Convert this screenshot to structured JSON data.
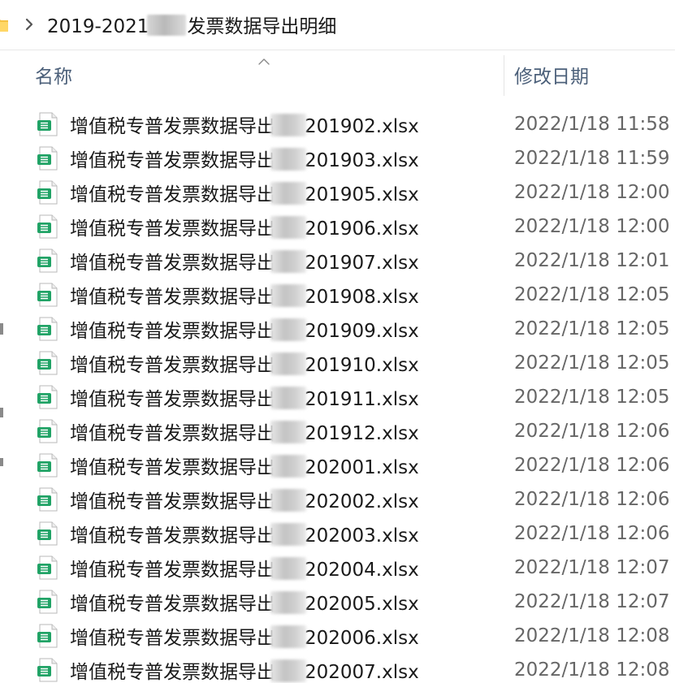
{
  "breadcrumb": {
    "folder_icon": "folder-icon",
    "separator_icon": "chevron-right-icon",
    "path_prefix": "2019-2021",
    "path_suffix": "发票数据导出明细"
  },
  "columns": {
    "name": "名称",
    "modified": "修改日期",
    "sort_icon": "sort-ascending-icon"
  },
  "file_icon": "excel-file-icon",
  "accent": "#21a366",
  "files": [
    {
      "name_prefix": "增值税专普发票数据导出",
      "name_suffix": "201902.xlsx",
      "modified": "2022/1/18 11:58"
    },
    {
      "name_prefix": "增值税专普发票数据导出",
      "name_suffix": "201903.xlsx",
      "modified": "2022/1/18 11:59"
    },
    {
      "name_prefix": "增值税专普发票数据导出",
      "name_suffix": "201905.xlsx",
      "modified": "2022/1/18 12:00"
    },
    {
      "name_prefix": "增值税专普发票数据导出",
      "name_suffix": "201906.xlsx",
      "modified": "2022/1/18 12:00"
    },
    {
      "name_prefix": "增值税专普发票数据导出",
      "name_suffix": "201907.xlsx",
      "modified": "2022/1/18 12:01"
    },
    {
      "name_prefix": "增值税专普发票数据导出",
      "name_suffix": "201908.xlsx",
      "modified": "2022/1/18 12:05"
    },
    {
      "name_prefix": "增值税专普发票数据导出",
      "name_suffix": "201909.xlsx",
      "modified": "2022/1/18 12:05"
    },
    {
      "name_prefix": "增值税专普发票数据导出",
      "name_suffix": "201910.xlsx",
      "modified": "2022/1/18 12:05"
    },
    {
      "name_prefix": "增值税专普发票数据导出",
      "name_suffix": "201911.xlsx",
      "modified": "2022/1/18 12:05"
    },
    {
      "name_prefix": "增值税专普发票数据导出",
      "name_suffix": "201912.xlsx",
      "modified": "2022/1/18 12:06"
    },
    {
      "name_prefix": "增值税专普发票数据导出",
      "name_suffix": "202001.xlsx",
      "modified": "2022/1/18 12:06"
    },
    {
      "name_prefix": "增值税专普发票数据导出",
      "name_suffix": "202002.xlsx",
      "modified": "2022/1/18 12:06"
    },
    {
      "name_prefix": "增值税专普发票数据导出",
      "name_suffix": "202003.xlsx",
      "modified": "2022/1/18 12:06"
    },
    {
      "name_prefix": "增值税专普发票数据导出",
      "name_suffix": "202004.xlsx",
      "modified": "2022/1/18 12:07"
    },
    {
      "name_prefix": "增值税专普发票数据导出",
      "name_suffix": "202005.xlsx",
      "modified": "2022/1/18 12:07"
    },
    {
      "name_prefix": "增值税专普发票数据导出",
      "name_suffix": "202006.xlsx",
      "modified": "2022/1/18 12:08"
    },
    {
      "name_prefix": "增值税专普发票数据导出",
      "name_suffix": "202007.xlsx",
      "modified": "2022/1/18 12:08"
    }
  ]
}
